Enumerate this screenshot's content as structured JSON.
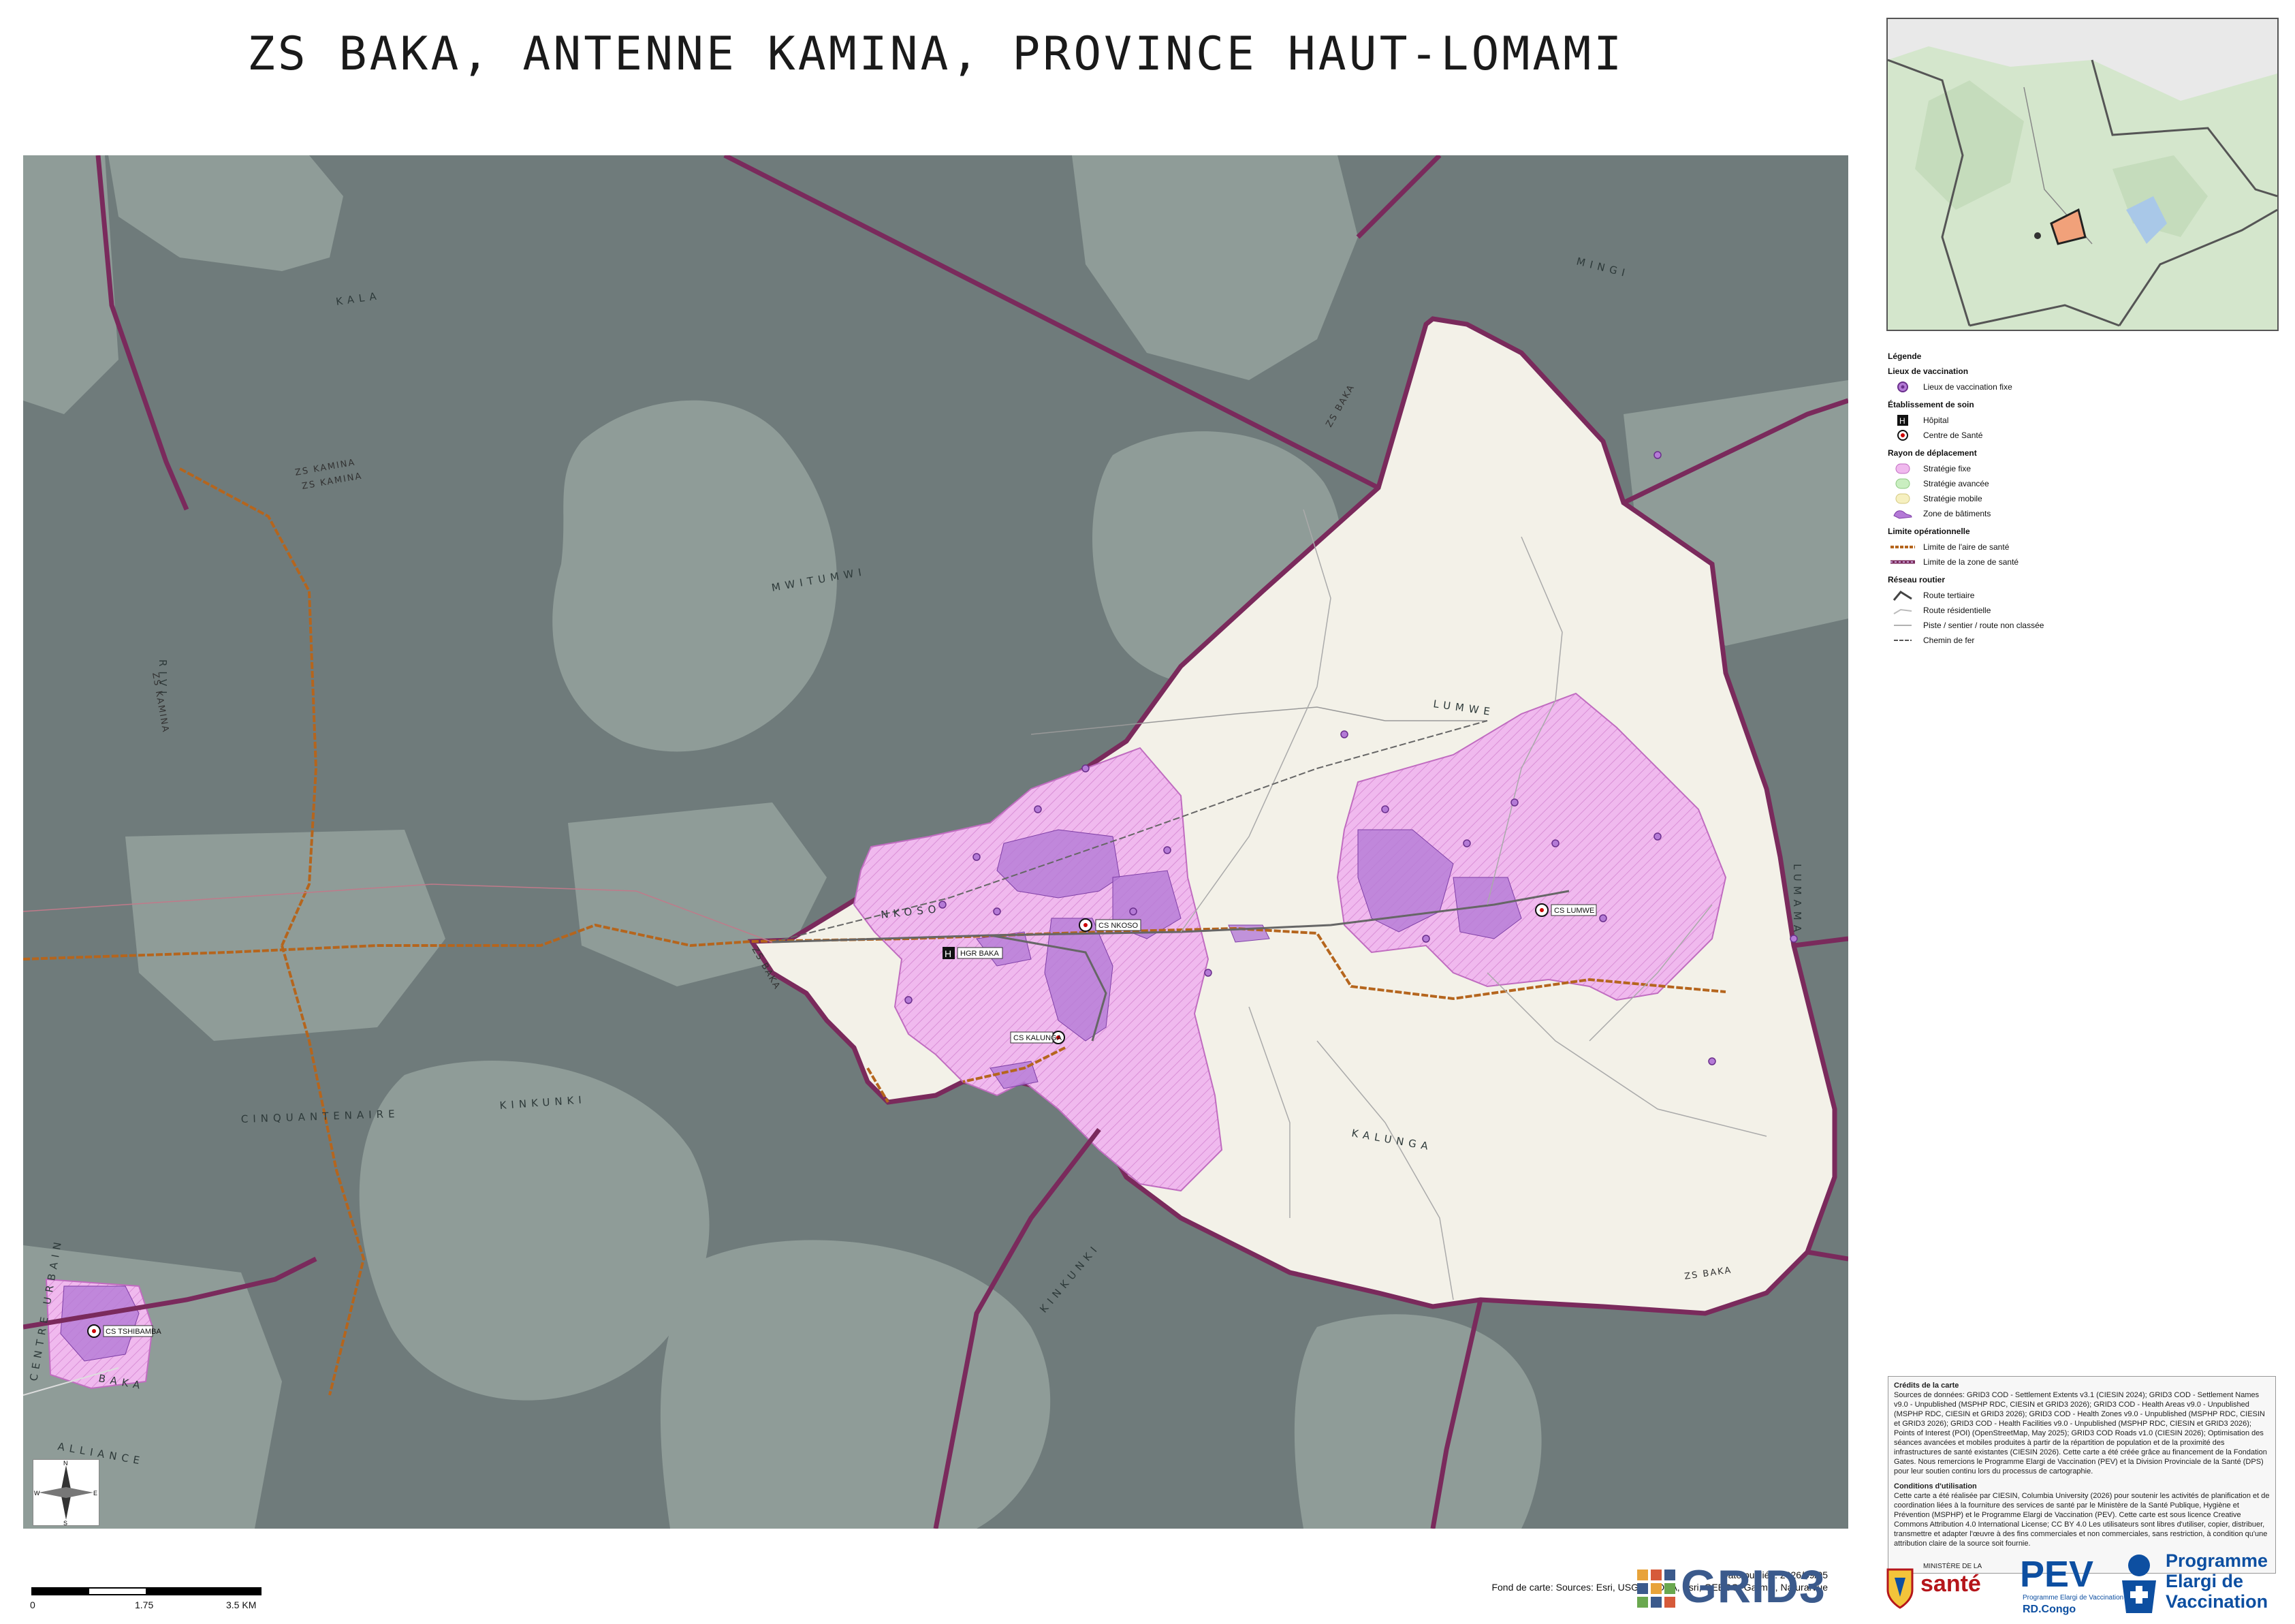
{
  "title": "ZS BAKA, ANTENNE KAMINA, PROVINCE HAUT-LOMAMI",
  "map": {
    "place_labels": {
      "lumwe": "LUMWE",
      "nkoso": "NKOSO",
      "kalunga": "KALUNGA",
      "lumama": "LUMAMA",
      "mwitumwi": "MWITUMWI",
      "mingi": "MINGI",
      "cinquantenaire": "CINQUANTENAIRE",
      "kinkunki": "KINKUNKI",
      "kinkunki_2": "KINKUNKI",
      "alliance": "ALLIANCE",
      "baka_side": "BAKA",
      "centre_urbain": "CENTRE URBAIN",
      "kala": "KALA",
      "rivi": "RIVI"
    },
    "zone_labels": {
      "zs_baka_top": "ZS BAKA",
      "zs_baka_bottom": "ZS BAKA",
      "zs_baka_west": "ZS BAKA",
      "zs_kamina_1": "ZS KAMINA",
      "zs_kamina_2": "ZS KAMINA",
      "zs_kamina_side": "ZS KAMINA"
    },
    "facilities": {
      "cs_nkoso": "CS NKOSO",
      "hgr_baka": "HGR BAKA",
      "cs_kalunga": "CS KALUNGA",
      "cs_lumwe": "CS LUMWE",
      "cs_tshibamba": "CS TSHIBAMBA"
    },
    "colors": {
      "outside": "#6f7b7b",
      "outside_light": "#8f9c98",
      "zone": "#f3f1e8",
      "strategie_fixe": "#f0b9ee",
      "batiments": "#b47ad6",
      "zone_border": "#7a2a5c",
      "aire_border": "#b5651d"
    }
  },
  "legend": {
    "title": "Légende",
    "groups": [
      {
        "heading": "Lieux de vaccination",
        "items": [
          {
            "label": "Lieux de vaccination fixe",
            "icon": "vaccination-site-icon"
          }
        ]
      },
      {
        "heading": "Établissement de soin",
        "items": [
          {
            "label": "Hôpital",
            "icon": "hospital-icon"
          },
          {
            "label": "Centre de Santé",
            "icon": "health-center-icon"
          }
        ]
      },
      {
        "heading": "Rayon de déplacement",
        "items": [
          {
            "label": "Stratégie fixe",
            "icon": "fixed-strategy-swatch"
          },
          {
            "label": "Stratégie avancée",
            "icon": "advanced-strategy-swatch"
          },
          {
            "label": "Stratégie mobile",
            "icon": "mobile-strategy-swatch"
          },
          {
            "label": "Zone de bâtiments",
            "icon": "building-zone-swatch"
          }
        ]
      },
      {
        "heading": "Limite opérationnelle",
        "items": [
          {
            "label": "Limite de l'aire de santé",
            "icon": "health-area-line"
          },
          {
            "label": "Limite de la zone de santé",
            "icon": "health-zone-line"
          }
        ]
      },
      {
        "heading": "Réseau routier",
        "items": [
          {
            "label": "Route tertiaire",
            "icon": "tertiary-road-line"
          },
          {
            "label": "Route résidentielle",
            "icon": "residential-road-line"
          },
          {
            "label": "Piste / sentier / route non classée",
            "icon": "track-line"
          },
          {
            "label": "Chemin de fer",
            "icon": "railway-line"
          }
        ]
      }
    ]
  },
  "credits": {
    "heading": "Crédits de la carte",
    "body": "Sources de données: GRID3 COD - Settlement Extents v3.1 (CIESIN 2024); GRID3 COD - Settlement Names v9.0 - Unpublished (MSPHP RDC, CIESIN et GRID3 2026); GRID3 COD - Health Areas v9.0 - Unpublished (MSPHP RDC, CIESIN et GRID3 2026); GRID3 COD - Health Zones v9.0 - Unpublished (MSPHP RDC, CIESIN et GRID3 2026); GRID3 COD - Health Facilities v9.0 - Unpublished (MSPHP RDC, CIESIN et GRID3 2026); Points of Interest (POI) (OpenStreetMap, May 2025); GRID3 COD Roads v1.0 (CIESIN 2026); Optimisation des séances avancées et mobiles produites à partir de la répartition de population et de la proximité des infrastructures de santé existantes (CIESIN 2026). Cette carte a été créée grâce au financement de la Fondation Gates. Nous remercions le Programme Elargi de Vaccination (PEV) et la Division Provinciale de la Santé (DPS) pour leur soutien continu lors du processus de cartographie.",
    "conditions_heading": "Conditions d'utilisation",
    "conditions_body": "Cette carte a été réalisée par CIESIN, Columbia University (2026) pour soutenir les activités de planification et de coordination liées à la fourniture des services de santé par le Ministère de la Santé Publique, Hygiène et Prévention (MSPHP) et le Programme Elargi de Vaccination (PEV). Cette carte est sous licence Creative Commons Attribution 4.0 International License; CC BY 4.0 Les utilisateurs sont libres d'utiliser, copier, distribuer, transmettre et adapter l'œuvre à des fins commerciales et non commerciales, sans restriction, à condition qu'une attribution claire de la source soit fournie."
  },
  "scale": {
    "labels": [
      "0",
      "1.75",
      "3.5 KM"
    ]
  },
  "publication": {
    "date": "Date publiée: 2026/09/05",
    "basemap": "Fond de carte: Sources: Esri, USGS, NOAA, Esri, GEBCO, Garmin, NaturalVue"
  },
  "logos": {
    "grid3": "GRID3",
    "ministere_top": "MINISTÈRE DE LA",
    "ministere_main": "santé",
    "pev_short": "PEV",
    "pev_sub": "Programme Elargi de Vaccination",
    "pev_country": "RD.Congo",
    "pev_full": "Programme Elargi de Vaccination"
  },
  "compass": {
    "n": "N",
    "s": "S",
    "e": "E",
    "w": "W"
  }
}
